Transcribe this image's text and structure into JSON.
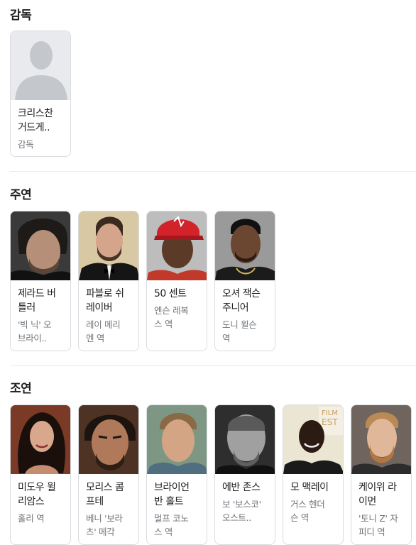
{
  "sections": {
    "director": {
      "title": "감독",
      "people": [
        {
          "name_line1": "크리스찬",
          "name_line2": "거드게..",
          "role": "감독"
        }
      ]
    },
    "main_cast": {
      "title": "주연",
      "people": [
        {
          "name_line1": "제라드 버",
          "name_line2": "틀러",
          "role_line1": "'빅 닉' 오",
          "role_line2": "브라이..",
          "photo_icon": "gerard-butler-photo"
        },
        {
          "name_line1": "파블로 쉬",
          "name_line2": "레이버",
          "role_line1": "레이 메리",
          "role_line2": "멘 역",
          "photo_icon": "pablo-schreiber-photo"
        },
        {
          "name_line1": "50 센트",
          "name_line2": "",
          "role_line1": "엔슨 레복",
          "role_line2": "스 역",
          "photo_icon": "50-cent-photo"
        },
        {
          "name_line1": "오셔 잭슨",
          "name_line2": "주니어",
          "role_line1": "도니 윌슨",
          "role_line2": "역",
          "photo_icon": "oshea-jackson-photo"
        }
      ]
    },
    "supporting_cast": {
      "title": "조연",
      "people": [
        {
          "name_line1": "미도우 윌",
          "name_line2": "리암스",
          "role_line1": "홀리 역",
          "role_line2": ""
        },
        {
          "name_line1": "모리스 콤",
          "name_line2": "프테",
          "role_line1": "베니 '보라",
          "role_line2": "츠' 메각"
        },
        {
          "name_line1": "브라이언",
          "name_line2": "반 홀트",
          "role_line1": "멀프 코노",
          "role_line2": "스 역"
        },
        {
          "name_line1": "에반 존스",
          "name_line2": "",
          "role_line1": "보 '보스코'",
          "role_line2": "오스트.."
        },
        {
          "name_line1": "모 맥레이",
          "name_line2": "",
          "role_line1": "거스 헨더",
          "role_line2": "슨 역"
        },
        {
          "name_line1": "케이위 라",
          "name_line2": "이먼",
          "role_line1": "'토니 Z' 자",
          "role_line2": "피디 역"
        }
      ]
    }
  },
  "colors": {
    "text": "#202124",
    "muted": "#70757a",
    "border": "#dadce0",
    "placeholder_bg": "#e8eaed",
    "placeholder_fg": "#bdc1c6"
  }
}
